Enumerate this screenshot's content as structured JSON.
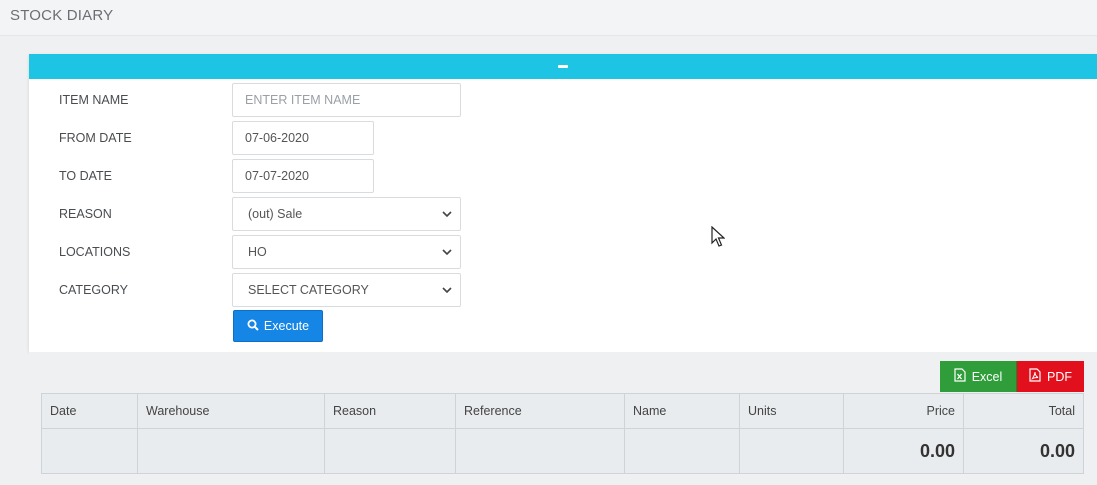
{
  "page": {
    "title": "STOCK DIARY"
  },
  "form": {
    "item_name": {
      "label": "ITEM NAME",
      "placeholder": "ENTER ITEM NAME"
    },
    "from_date": {
      "label": "FROM DATE",
      "value": "07-06-2020"
    },
    "to_date": {
      "label": "TO DATE",
      "value": "07-07-2020"
    },
    "reason": {
      "label": "REASON",
      "value": "(out) Sale"
    },
    "locations": {
      "label": "LOCATIONS",
      "value": "HO"
    },
    "category": {
      "label": "CATEGORY",
      "value": "SELECT CATEGORY"
    },
    "execute_label": "Execute"
  },
  "export": {
    "excel_label": "Excel",
    "pdf_label": "PDF"
  },
  "table": {
    "columns": [
      "Date",
      "Warehouse",
      "Reason",
      "Reference",
      "Name",
      "Units",
      "Price",
      "Total"
    ],
    "totals": {
      "price": "0.00",
      "total": "0.00"
    }
  },
  "colors": {
    "panel_header": "#1ec4e4",
    "execute": "#1585e6",
    "excel": "#2f9e3a",
    "pdf": "#e1101c"
  },
  "icons": {
    "collapse": "minus-icon",
    "execute": "search-icon",
    "excel": "excel-file-icon",
    "pdf": "pdf-file-icon",
    "select": "chevron-down-icon",
    "cursor": "mouse-cursor-icon"
  }
}
